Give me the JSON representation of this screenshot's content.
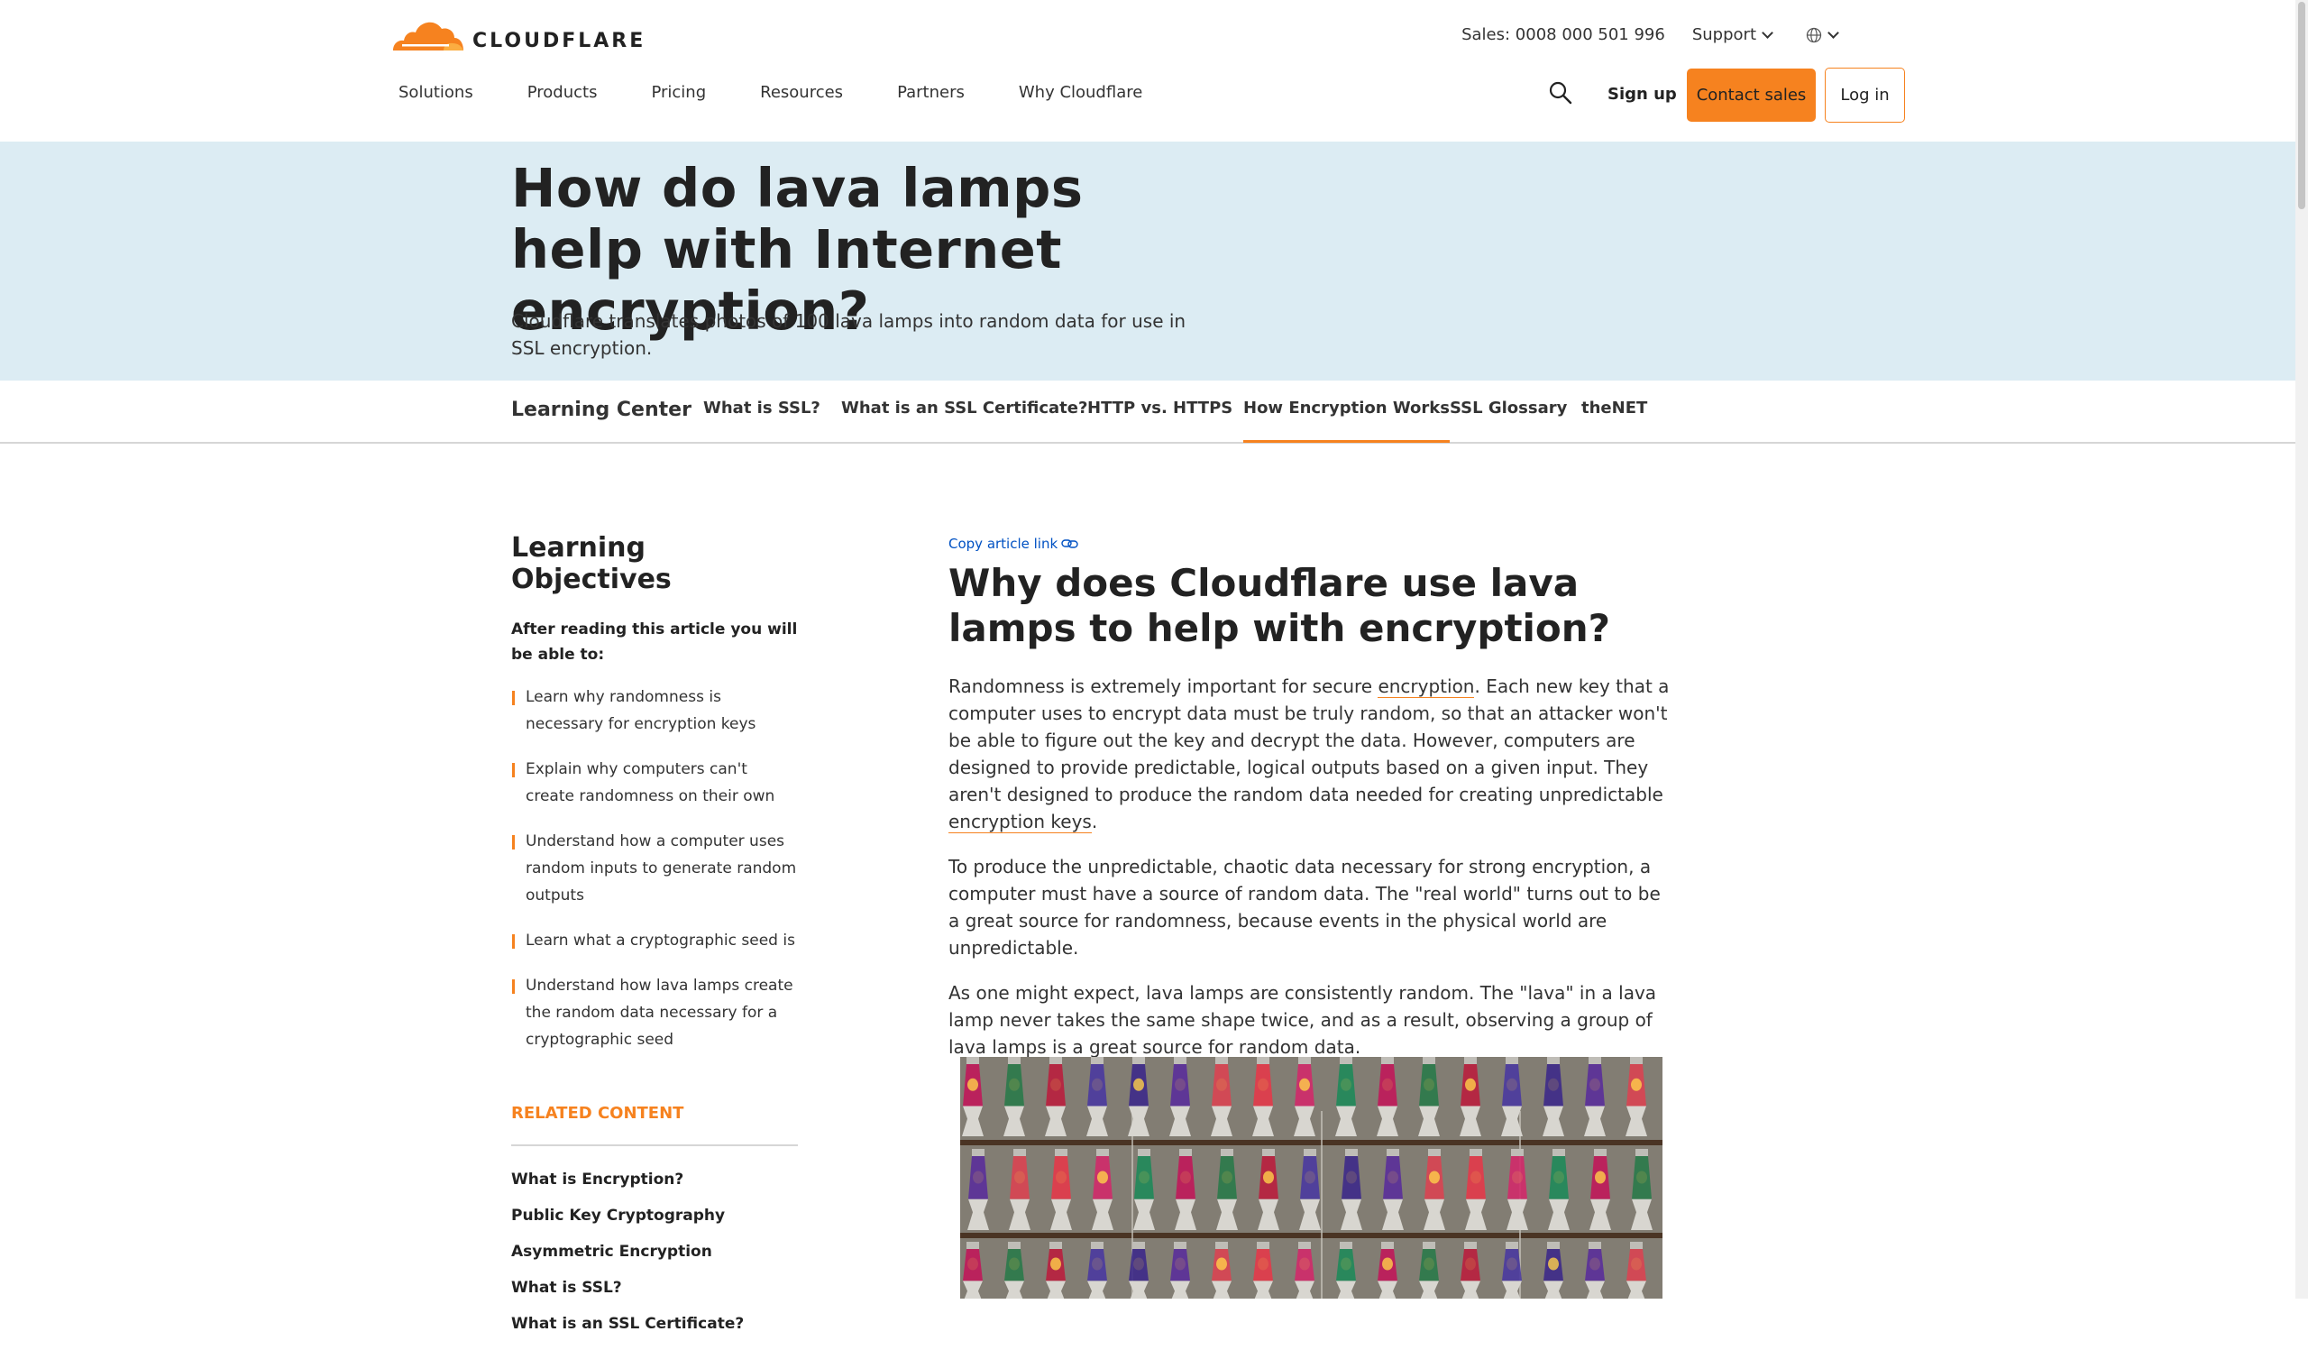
{
  "header": {
    "logo_text": "CLOUDFLARE",
    "sales": "Sales: 0008 000 501 996",
    "support": "Support",
    "nav": [
      "Solutions",
      "Products",
      "Pricing",
      "Resources",
      "Partners",
      "Why Cloudflare"
    ],
    "signup": "Sign up",
    "contact_sales": "Contact sales",
    "login": "Log in"
  },
  "hero": {
    "title": "How do lava lamps help with Internet encryption?",
    "subtitle": "Cloudflare translates photos of 100 lava lamps into random data for use in SSL encryption."
  },
  "subnav": {
    "learning_center": "Learning Center",
    "tabs": [
      "What is SSL?",
      "What is an SSL Certificate?",
      "HTTP vs. HTTPS",
      "How Encryption Works",
      "SSL Glossary",
      "theNET"
    ],
    "active_tab": "How Encryption Works"
  },
  "sidebar": {
    "title": "Learning Objectives",
    "intro": "After reading this article you will be able to:",
    "objectives": [
      "Learn why randomness is necessary for encryption keys",
      "Explain why computers can't create randomness on their own",
      "Understand how a computer uses random inputs to generate random outputs",
      "Learn what a cryptographic seed is",
      "Understand how lava lamps create the random data necessary for a cryptographic seed"
    ],
    "related_title": "RELATED CONTENT",
    "related": [
      "What is Encryption?",
      "Public Key Cryptography",
      "Asymmetric Encryption",
      "What is SSL?",
      "What is an SSL Certificate?"
    ]
  },
  "article": {
    "copy_link": "Copy article link",
    "title": "Why does Cloudflare use lava lamps to help with encryption?",
    "p1": {
      "a": "Randomness is extremely important for secure ",
      "link1": "encryption",
      "b": ". Each new key that a computer uses to encrypt data must be truly random, so that an attacker won't be able to figure out the key and decrypt the data. However, computers are designed to provide predictable, logical outputs based on a given input. They aren't designed to produce the random data needed for creating unpredictable ",
      "link2": "encryption keys",
      "c": "."
    },
    "p2": "To produce the unpredictable, chaotic data necessary for strong encryption, a computer must have a source of random data. The \"real world\" turns out to be a great source for randomness, because events in the physical world are unpredictable.",
    "p3": "As one might expect, lava lamps are consistently random. The \"lava\" in a lava lamp never takes the same shape twice, and as a result, observing a group of lava lamps is a great source for random data."
  },
  "colors": {
    "accent": "#f6821f",
    "hero_bg": "#dcecf3",
    "link_blue": "#0051c3"
  },
  "icons": [
    "cloudflare-logo",
    "chevron-down-icon",
    "globe-icon",
    "search-icon",
    "link-icon"
  ]
}
